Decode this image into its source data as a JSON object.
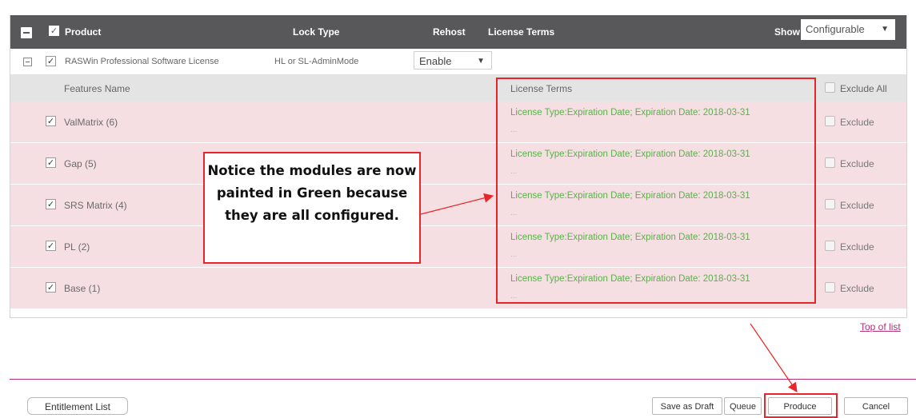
{
  "header": {
    "product_label": "Product",
    "lock_type_label": "Lock Type",
    "rehost_label": "Rehost",
    "license_terms_label": "License Terms",
    "show_label": "Show:",
    "show_value": "Configurable"
  },
  "product_row": {
    "name": "RASWin Professional Software License",
    "lock_type": "HL or SL-AdminMode",
    "rehost_value": "Enable"
  },
  "features_header": {
    "features_name": "Features Name",
    "license_terms": "License Terms",
    "exclude_all": "Exclude All"
  },
  "features": [
    {
      "name": "ValMatrix (6)",
      "license_terms": "License Type:Expiration Date; Expiration Date: 2018-03-31",
      "ellipsis": "...",
      "exclude_label": "Exclude"
    },
    {
      "name": "Gap (5)",
      "license_terms": "License Type:Expiration Date; Expiration Date: 2018-03-31",
      "ellipsis": "...",
      "exclude_label": "Exclude"
    },
    {
      "name": "SRS Matrix (4)",
      "license_terms": "License Type:Expiration Date; Expiration Date: 2018-03-31",
      "ellipsis": "...",
      "exclude_label": "Exclude"
    },
    {
      "name": "PL (2)",
      "license_terms": "License Type:Expiration Date; Expiration Date: 2018-03-31",
      "ellipsis": "...",
      "exclude_label": "Exclude"
    },
    {
      "name": "Base (1)",
      "license_terms": "License Type:Expiration Date; Expiration Date: 2018-03-31",
      "ellipsis": "...",
      "exclude_label": "Exclude"
    }
  ],
  "top_of_list": "Top of list",
  "buttons": {
    "entitlement_list": "Entitlement List",
    "save_as_draft": "Save as Draft",
    "queue": "Queue",
    "produce": "Produce",
    "cancel": "Cancel"
  },
  "annotation": {
    "text": "Notice the modules are now painted in Green because they are all configured."
  },
  "colors": {
    "header_bg": "#58585a",
    "row_pink": "#f5dfe3",
    "license_green": "#5ab04a",
    "annotation_red": "#e8252a",
    "link_magenta": "#b0307a"
  }
}
